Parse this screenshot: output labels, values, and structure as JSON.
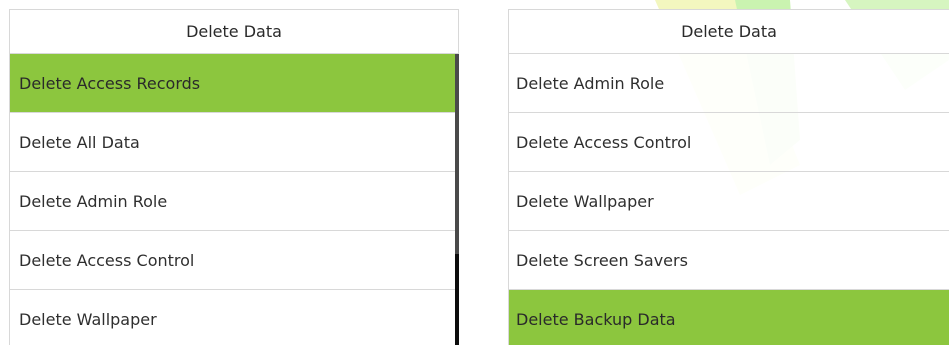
{
  "left_panel": {
    "title": "Delete Data",
    "items": [
      {
        "label": "Delete Access Records",
        "selected": true
      },
      {
        "label": "Delete All Data",
        "selected": false
      },
      {
        "label": "Delete Admin Role",
        "selected": false
      },
      {
        "label": "Delete Access Control",
        "selected": false
      },
      {
        "label": "Delete Wallpaper",
        "selected": false
      }
    ]
  },
  "right_panel": {
    "title": "Delete Data",
    "items": [
      {
        "label": "Delete Admin Role",
        "selected": false
      },
      {
        "label": "Delete Access Control",
        "selected": false
      },
      {
        "label": "Delete Wallpaper",
        "selected": false
      },
      {
        "label": "Delete Screen Savers",
        "selected": false
      },
      {
        "label": "Delete Backup Data",
        "selected": true
      }
    ]
  },
  "colors": {
    "selected_background": "#8cc63e",
    "watermark_green": "#caf3b0",
    "watermark_yellow": "#f3f7bf",
    "border": "#d8d8d8",
    "scrollbar": "#1a1a1a"
  }
}
